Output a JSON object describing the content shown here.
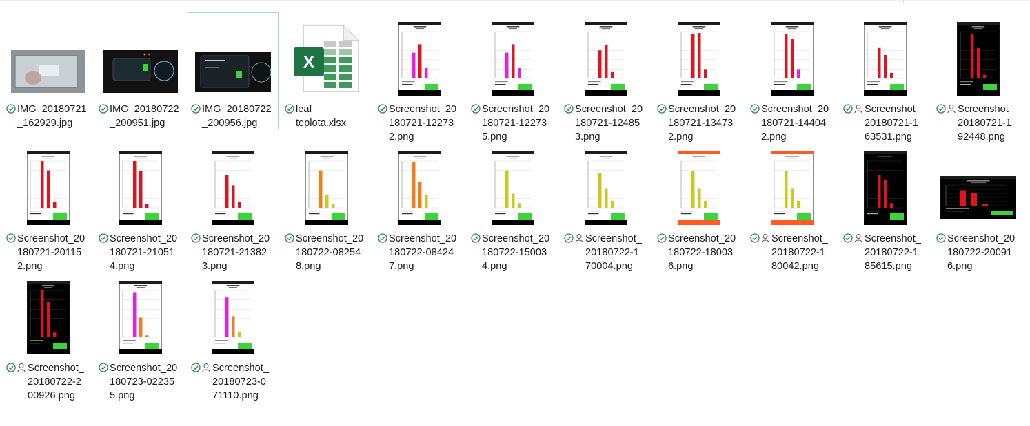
{
  "colors": {
    "status_green": "#2a8a3e",
    "selection_border": "#99d1ff",
    "excel_green": "#1f7244",
    "bar_red": "#e0141e",
    "bar_magenta": "#e91ee6",
    "bar_orange": "#f07e1e",
    "bar_yellow": "#c9c91e",
    "status_bar_green": "#3bd43b"
  },
  "files": [
    {
      "name": "IMG_20180721\n_162929.jpg",
      "kind": "photo-laptop",
      "shared": false,
      "selected": false
    },
    {
      "name": "IMG_20180722\n_200951.jpg",
      "kind": "photo-dash",
      "shared": false,
      "selected": false
    },
    {
      "name": "IMG_20180722\n_200956.jpg",
      "kind": "photo-display",
      "shared": false,
      "selected": true
    },
    {
      "name": "leaf\nteplota.xlsx",
      "kind": "excel",
      "shared": false,
      "selected": false
    },
    {
      "name": "Screenshot_20\n180721-12273\n2.png",
      "kind": "screenshot",
      "theme": "light",
      "bars": [
        0.55,
        0.73,
        0.22
      ],
      "bar_colors": [
        "bar_magenta",
        "bar_red",
        "bar_magenta"
      ],
      "soc": "SOC= 59.3%",
      "shared": false,
      "selected": false
    },
    {
      "name": "Screenshot_20\n180721-12273\n5.png",
      "kind": "screenshot",
      "theme": "light",
      "bars": [
        0.55,
        0.73,
        0.22
      ],
      "bar_colors": [
        "bar_magenta",
        "bar_red",
        "bar_magenta"
      ],
      "soc": "SOC= 59.4%",
      "shared": false,
      "selected": false
    },
    {
      "name": "Screenshot_20\n180721-12485\n3.png",
      "kind": "screenshot",
      "theme": "light",
      "bars": [
        0.6,
        0.72,
        0.15
      ],
      "bar_colors": [
        "bar_red",
        "bar_red",
        "bar_red"
      ],
      "soc": "SOC= 74.9%",
      "shared": false,
      "selected": false
    },
    {
      "name": "Screenshot_20\n180721-13473\n2.png",
      "kind": "screenshot",
      "theme": "light",
      "bars": [
        0.95,
        0.97,
        0.2
      ],
      "bar_colors": [
        "bar_red",
        "bar_red",
        "bar_red"
      ],
      "soc": "SOC= 48.8%",
      "shared": false,
      "selected": false
    },
    {
      "name": "Screenshot_20\n180721-14404\n2.png",
      "kind": "screenshot",
      "theme": "light",
      "bars": [
        0.95,
        0.85,
        0.2
      ],
      "bar_colors": [
        "bar_red",
        "bar_red",
        "bar_magenta"
      ],
      "soc": "SOC= 48.8%",
      "shared": false,
      "selected": false
    },
    {
      "name": "Screenshot_\n20180721-1\n63531.png",
      "kind": "screenshot",
      "theme": "light",
      "bars": [
        0.65,
        0.5,
        0.12
      ],
      "bar_colors": [
        "bar_red",
        "bar_red",
        "bar_red"
      ],
      "soc": "SOC= 62.3%",
      "shared": true,
      "selected": false
    },
    {
      "name": "Screenshot_\n20180721-1\n92448.png",
      "kind": "screenshot",
      "theme": "dark",
      "bars": [
        0.95,
        0.65,
        0.08
      ],
      "bar_colors": [
        "bar_red",
        "bar_red",
        "bar_red"
      ],
      "soc": "",
      "shared": true,
      "selected": false
    },
    {
      "name": "Screenshot_20\n180721-20115\n2.png",
      "kind": "screenshot",
      "theme": "light",
      "bars": [
        1.0,
        0.8,
        0.12
      ],
      "bar_colors": [
        "bar_red",
        "bar_red",
        "bar_red"
      ],
      "soc": "SOC= 41.7%",
      "shared": false,
      "selected": false
    },
    {
      "name": "Screenshot_20\n180721-21051\n4.png",
      "kind": "screenshot",
      "theme": "light",
      "bars": [
        1.0,
        0.78,
        0.08
      ],
      "bar_colors": [
        "bar_red",
        "bar_red",
        "bar_red"
      ],
      "soc": "SOC= 77.6%",
      "shared": false,
      "selected": false
    },
    {
      "name": "Screenshot_20\n180721-21382\n3.png",
      "kind": "screenshot",
      "theme": "light",
      "bars": [
        0.7,
        0.48,
        0.12
      ],
      "bar_colors": [
        "bar_red",
        "bar_red",
        "bar_red"
      ],
      "soc": "SOC= 40.5%",
      "shared": false,
      "selected": false
    },
    {
      "name": "Screenshot_20\n180722-08254\n8.png",
      "kind": "screenshot",
      "theme": "light",
      "bars": [
        0.8,
        0.28,
        0.08
      ],
      "bar_colors": [
        "bar_orange",
        "bar_yellow",
        "bar_yellow"
      ],
      "soc": "SOC= 87.3%",
      "shared": false,
      "selected": false
    },
    {
      "name": "Screenshot_20\n180722-08424\n7.png",
      "kind": "screenshot",
      "theme": "light",
      "bars": [
        0.98,
        0.55,
        0.28
      ],
      "bar_colors": [
        "bar_orange",
        "bar_orange",
        "bar_yellow"
      ],
      "soc": "SOC= 86.8%",
      "shared": false,
      "selected": false
    },
    {
      "name": "Screenshot_20\n180722-15003\n4.png",
      "kind": "screenshot",
      "theme": "light",
      "bars": [
        0.8,
        0.3,
        0.1
      ],
      "bar_colors": [
        "bar_yellow",
        "bar_yellow",
        "bar_yellow"
      ],
      "soc": "SOC= 56.4%",
      "shared": false,
      "selected": false
    },
    {
      "name": "Screenshot_\n20180722-1\n70004.png",
      "kind": "screenshot",
      "theme": "light",
      "bars": [
        0.75,
        0.42,
        0.15
      ],
      "bar_colors": [
        "bar_yellow",
        "bar_yellow",
        "bar_yellow"
      ],
      "soc": "SOC= 44.5%",
      "shared": true,
      "selected": false
    },
    {
      "name": "Screenshot_20\n180722-18003\n6.png",
      "kind": "screenshot",
      "theme": "orange",
      "bars": [
        0.78,
        0.42,
        0.15
      ],
      "bar_colors": [
        "bar_yellow",
        "bar_yellow",
        "bar_yellow"
      ],
      "soc": "SOC= 22.6%",
      "shared": false,
      "selected": false
    },
    {
      "name": "Screenshot_\n20180722-1\n80042.png",
      "kind": "screenshot",
      "theme": "orange",
      "bars": [
        0.78,
        0.42,
        0.15
      ],
      "bar_colors": [
        "bar_yellow",
        "bar_yellow",
        "bar_yellow"
      ],
      "soc": "SOC= 22.6%",
      "shared": true,
      "selected": false
    },
    {
      "name": "Screenshot_\n20180722-1\n85615.png",
      "kind": "screenshot",
      "theme": "dark",
      "bars": [
        0.7,
        0.6,
        0.1
      ],
      "bar_colors": [
        "bar_red",
        "bar_red",
        "bar_red"
      ],
      "soc": "SOC= 64.0%",
      "shared": true,
      "selected": false
    },
    {
      "name": "Screenshot_20\n180722-20091\n6.png",
      "kind": "screenshot",
      "theme": "dark-wide",
      "bars": [
        0.75,
        0.62,
        0.08
      ],
      "bar_colors": [
        "bar_red",
        "bar_red",
        "bar_red"
      ],
      "soc": "SOC= 28.3%",
      "shared": false,
      "selected": false
    },
    {
      "name": "Screenshot_\n20180722-2\n00926.png",
      "kind": "screenshot",
      "theme": "dark",
      "bars": [
        1.0,
        0.75,
        0.1
      ],
      "bar_colors": [
        "bar_red",
        "bar_red",
        "bar_red"
      ],
      "soc": "SOC= 28.3%",
      "shared": true,
      "selected": false
    },
    {
      "name": "Screenshot_20\n180723-02235\n5.png",
      "kind": "screenshot",
      "theme": "light",
      "bars": [
        0.95,
        0.42,
        0.04
      ],
      "bar_colors": [
        "bar_magenta",
        "bar_orange",
        "bar_orange"
      ],
      "soc": "SOC= 28.2%",
      "shared": false,
      "selected": false
    },
    {
      "name": "Screenshot_\n20180723-0\n71110.png",
      "kind": "screenshot",
      "theme": "light",
      "bars": [
        0.85,
        0.45,
        0.12
      ],
      "bar_colors": [
        "bar_magenta",
        "bar_orange",
        "bar_yellow"
      ],
      "soc": "SOC= 50.4%",
      "shared": true,
      "selected": false
    }
  ]
}
